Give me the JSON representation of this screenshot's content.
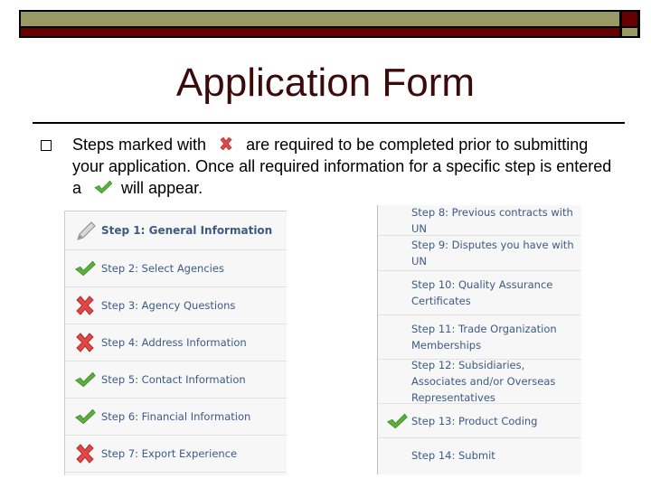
{
  "slide": {
    "title": "Application Form",
    "bullet": {
      "text_before_x": "Steps marked with",
      "text_after_x": "are required to be completed prior to submitting your application. Once all required information for a specific step is entered a",
      "text_after_check": "will appear.",
      "required_icon": "red-x-icon",
      "complete_icon": "green-check-icon"
    }
  },
  "colors": {
    "banner_olive": "#999966",
    "banner_red": "#660000",
    "title": "#3b0a0a",
    "step_text": "#3d5a84",
    "check_green": "#5cb03c",
    "x_red": "#e04848"
  },
  "steps_left": [
    {
      "label": "Step 1: General Information",
      "status": "editing",
      "icon": "pencil-icon"
    },
    {
      "label": "Step 2: Select Agencies",
      "status": "complete",
      "icon": "green-check-icon"
    },
    {
      "label": "Step 3: Agency Questions",
      "status": "required",
      "icon": "red-x-icon"
    },
    {
      "label": "Step 4: Address Information",
      "status": "required",
      "icon": "red-x-icon"
    },
    {
      "label": "Step 5: Contact Information",
      "status": "complete",
      "icon": "green-check-icon"
    },
    {
      "label": "Step 6: Financial Information",
      "status": "complete",
      "icon": "green-check-icon"
    },
    {
      "label": "Step 7: Export Experience",
      "status": "required",
      "icon": "red-x-icon"
    }
  ],
  "steps_right": [
    {
      "label": "Step 8: Previous contracts with UN",
      "status": "none"
    },
    {
      "label": "Step 9: Disputes you have with UN",
      "status": "none"
    },
    {
      "label": "Step 10: Quality Assurance Certificates",
      "status": "none"
    },
    {
      "label": "Step 11: Trade Organization Memberships",
      "status": "none"
    },
    {
      "label": "Step 12: Subsidiaries, Associates and/or Overseas Representatives",
      "status": "none"
    },
    {
      "label": "Step 13: Product Coding",
      "status": "complete",
      "icon": "green-check-icon"
    },
    {
      "label": "Step 14: Submit",
      "status": "none"
    }
  ]
}
